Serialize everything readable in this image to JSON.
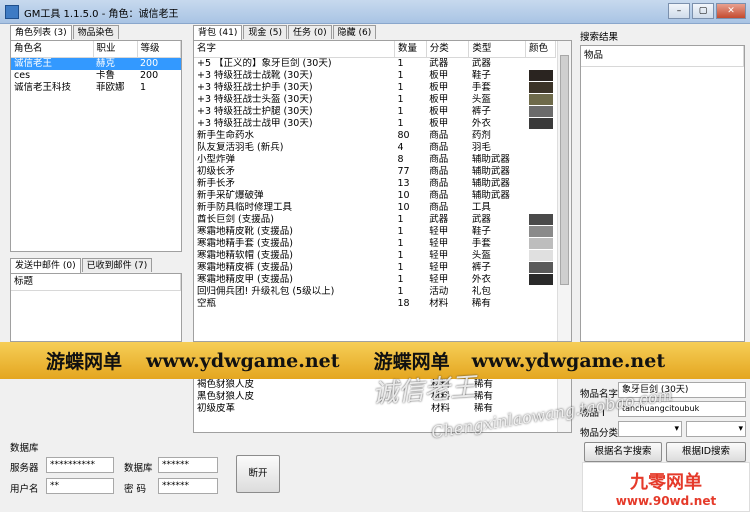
{
  "window": {
    "title": "GM工具 1.1.5.0  -  角色：诚信老王",
    "buttons": [
      "–",
      "▢",
      "✕"
    ]
  },
  "left": {
    "tabs": [
      "角色列表 (3)",
      "物品染色"
    ],
    "headers": [
      "角色名",
      "职业",
      "等级"
    ],
    "rows": [
      [
        "诚信老王",
        "赫克",
        "200"
      ],
      [
        "ces",
        "卡鲁",
        "200"
      ],
      [
        "诚信老王科技",
        "菲欧娜",
        "1"
      ]
    ],
    "mail_tabs": [
      "发送中邮件 (0)",
      "已收到邮件 (7)"
    ],
    "mail_header": "标题"
  },
  "db": {
    "title": "数据库",
    "server_label": "服务器",
    "server_value": "**********",
    "database_label": "数据库",
    "database_value": "******",
    "user_label": "用户名",
    "user_value": "**",
    "password_label": "密  码",
    "password_value": "******",
    "disconnect_button": "断开"
  },
  "middle": {
    "tabs": [
      "背包 (41)",
      "现金 (5)",
      "任务 (0)",
      "隐藏 (6)"
    ],
    "headers": [
      "名字",
      "数量",
      "分类",
      "类型",
      "颜色"
    ],
    "rows": [
      [
        "+5 【正义的】象牙巨剑 (30天)",
        "1",
        "武器",
        "武器",
        ""
      ],
      [
        "+3 特级狂战士战靴 (30天)",
        "1",
        "板甲",
        "鞋子",
        "#2a2420"
      ],
      [
        "+3 特级狂战士护手 (30天)",
        "1",
        "板甲",
        "手套",
        "#3c3428"
      ],
      [
        "+3 特级狂战士头盔 (30天)",
        "1",
        "板甲",
        "头盔",
        "#6e6a4a"
      ],
      [
        "+3 特级狂战士护腿 (30天)",
        "1",
        "板甲",
        "裤子",
        "#6b6b6b"
      ],
      [
        "+3 特级狂战士战甲 (30天)",
        "1",
        "板甲",
        "外衣",
        "#3a3a3a"
      ],
      [
        "新手生命药水",
        "80",
        "商品",
        "药剂",
        ""
      ],
      [
        "队友复活羽毛 (新兵)",
        "4",
        "商品",
        "羽毛",
        ""
      ],
      [
        "小型炸弹",
        "8",
        "商品",
        "辅助武器",
        ""
      ],
      [
        "初级长矛",
        "77",
        "商品",
        "辅助武器",
        ""
      ],
      [
        "新手长矛",
        "13",
        "商品",
        "辅助武器",
        ""
      ],
      [
        "新手采矿爆破弹",
        "10",
        "商品",
        "辅助武器",
        ""
      ],
      [
        "新手防具临时修理工具",
        "10",
        "商品",
        "工具",
        ""
      ],
      [
        "酋长巨剑 (支援品)",
        "1",
        "武器",
        "武器",
        "#4a4a4a"
      ],
      [
        "寒霜地精皮靴 (支援品)",
        "1",
        "轻甲",
        "鞋子",
        "#8a8a8a"
      ],
      [
        "寒霜地精手套 (支援品)",
        "1",
        "轻甲",
        "手套",
        "#bdbdbd"
      ],
      [
        "寒霜地精软帽 (支援品)",
        "1",
        "轻甲",
        "头盔",
        "#e0e0e0"
      ],
      [
        "寒霜地精皮裤 (支援品)",
        "1",
        "轻甲",
        "裤子",
        "#5a5a5a"
      ],
      [
        "寒霜地精皮甲 (支援品)",
        "1",
        "轻甲",
        "外衣",
        "#2a2a2a"
      ],
      [
        "回归佣兵团! 升级礼包 (5级以上)",
        "1",
        "活动",
        "礼包",
        ""
      ],
      [
        "空瓶",
        "18",
        "材料",
        "稀有",
        ""
      ]
    ],
    "rows_below": [
      [
        "褐色豺狼人皮",
        "",
        "材料",
        "稀有",
        ""
      ],
      [
        "黑色豺狼人皮",
        "",
        "材料",
        "稀有",
        ""
      ],
      [
        "初级皮革",
        "",
        "材料",
        "稀有",
        ""
      ]
    ]
  },
  "right": {
    "title": "搜索结果",
    "header": "物品",
    "item_name_label": "物品名字",
    "item_name_value": "象牙巨剑 (30天)",
    "item_id_label": "物品 I",
    "item_id_value": "tanchuangcitoubuk",
    "item_type_label": "物品分类",
    "search_name_button": "根据名字搜索",
    "search_id_button": "根据ID搜索"
  },
  "banner": {
    "parts": [
      "游蝶网单",
      "www.ydwgame.net",
      "游蝶网单",
      "www.ydwgame.net"
    ]
  },
  "watermarks": {
    "script": "诚信老王",
    "url": "Chengxinlaowang.taobao.com",
    "logo_title": "九零网单",
    "logo_url": "www.90wd.net"
  }
}
